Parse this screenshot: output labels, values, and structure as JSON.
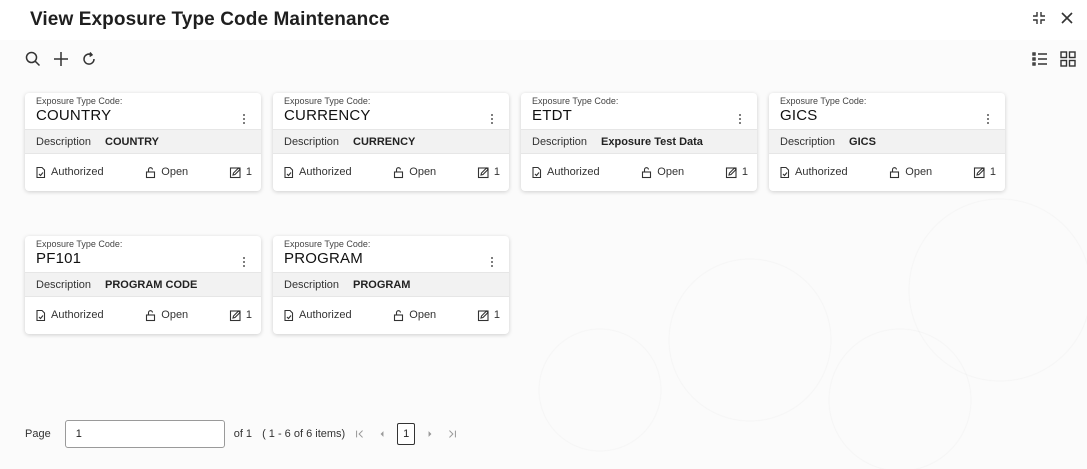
{
  "header": {
    "title": "View Exposure Type Code Maintenance"
  },
  "toolbar": {
    "icons": [
      "search-icon",
      "add-icon",
      "refresh-icon"
    ],
    "view_icons": [
      "list-view-icon",
      "grid-view-icon"
    ]
  },
  "cards": [
    {
      "code_label": "Exposure Type Code:",
      "code": "COUNTRY",
      "desc_label": "Description",
      "desc_value": "COUNTRY",
      "status": "Authorized",
      "lock": "Open",
      "version": "1"
    },
    {
      "code_label": "Exposure Type Code:",
      "code": "CURRENCY",
      "desc_label": "Description",
      "desc_value": "CURRENCY",
      "status": "Authorized",
      "lock": "Open",
      "version": "1"
    },
    {
      "code_label": "Exposure Type Code:",
      "code": "ETDT",
      "desc_label": "Description",
      "desc_value": "Exposure Test Data",
      "status": "Authorized",
      "lock": "Open",
      "version": "1"
    },
    {
      "code_label": "Exposure Type Code:",
      "code": "GICS",
      "desc_label": "Description",
      "desc_value": "GICS",
      "status": "Authorized",
      "lock": "Open",
      "version": "1"
    },
    {
      "code_label": "Exposure Type Code:",
      "code": "PF101",
      "desc_label": "Description",
      "desc_value": "PROGRAM CODE",
      "status": "Authorized",
      "lock": "Open",
      "version": "1"
    },
    {
      "code_label": "Exposure Type Code:",
      "code": "PROGRAM",
      "desc_label": "Description",
      "desc_value": "PROGRAM",
      "status": "Authorized",
      "lock": "Open",
      "version": "1"
    }
  ],
  "pager": {
    "label": "Page",
    "value": "1",
    "of_text": "of 1",
    "items_text": "( 1 - 6 of 6 items)",
    "current_page": "1"
  }
}
